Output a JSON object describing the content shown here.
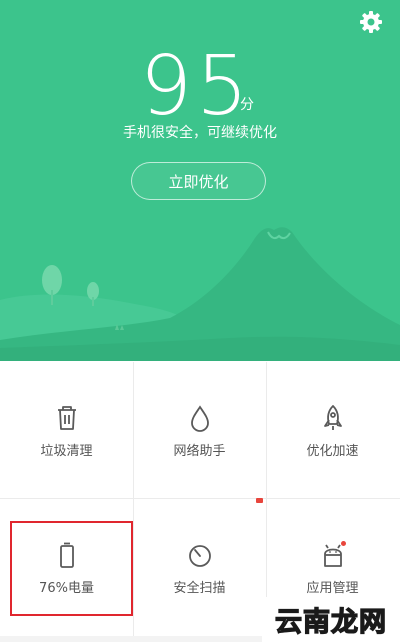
{
  "header": {
    "settings_icon": "gear-icon",
    "score": "95",
    "score_unit": "分",
    "status": "手机很安全，可继续优化",
    "optimize_button": "立即优化"
  },
  "tools": [
    {
      "label": "垃圾清理",
      "icon": "trash-icon"
    },
    {
      "label": "网络助手",
      "icon": "droplet-icon"
    },
    {
      "label": "优化加速",
      "icon": "rocket-icon"
    },
    {
      "label": "76%电量",
      "icon": "battery-icon"
    },
    {
      "label": "安全扫描",
      "icon": "scan-gauge-icon"
    },
    {
      "label": "应用管理",
      "icon": "android-icon"
    }
  ],
  "watermark": "云南龙网",
  "colors": {
    "hero_green": "#3cc48c",
    "highlight_red": "#e0262e",
    "badge_red": "#e8453c"
  }
}
